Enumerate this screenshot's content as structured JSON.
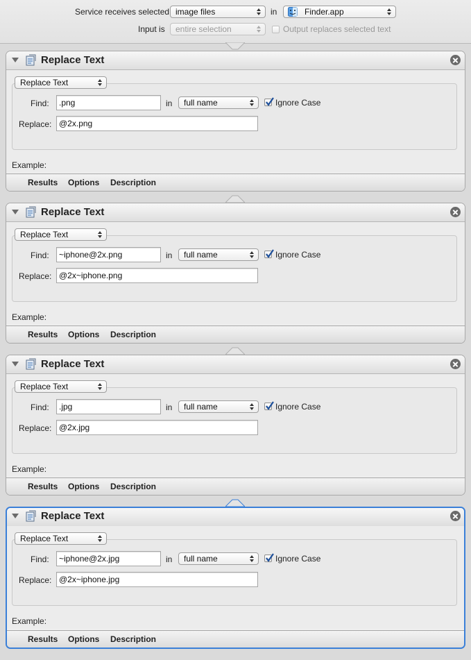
{
  "header": {
    "service_receives_label": "Service receives selected",
    "service_receives_value": "image files",
    "in_label": "in",
    "app_value": "Finder.app",
    "input_is_label": "Input is",
    "input_is_value": "entire selection",
    "output_replaces_label": "Output replaces selected text",
    "output_replaces_checked": false
  },
  "actions": [
    {
      "title": "Replace Text",
      "mode": "Replace Text",
      "find_label": "Find:",
      "find_value": ".png",
      "in_label": "in",
      "in_value": "full name",
      "ignore_case_label": "Ignore Case",
      "ignore_case_checked": true,
      "replace_label": "Replace:",
      "replace_value": "@2x.png",
      "example_label": "Example:",
      "tabs": [
        "Results",
        "Options",
        "Description"
      ],
      "selected": false
    },
    {
      "title": "Replace Text",
      "mode": "Replace Text",
      "find_label": "Find:",
      "find_value": "~iphone@2x.png",
      "in_label": "in",
      "in_value": "full name",
      "ignore_case_label": "Ignore Case",
      "ignore_case_checked": true,
      "replace_label": "Replace:",
      "replace_value": "@2x~iphone.png",
      "example_label": "Example:",
      "tabs": [
        "Results",
        "Options",
        "Description"
      ],
      "selected": false
    },
    {
      "title": "Replace Text",
      "mode": "Replace Text",
      "find_label": "Find:",
      "find_value": ".jpg",
      "in_label": "in",
      "in_value": "full name",
      "ignore_case_label": "Ignore Case",
      "ignore_case_checked": true,
      "replace_label": "Replace:",
      "replace_value": "@2x.jpg",
      "example_label": "Example:",
      "tabs": [
        "Results",
        "Options",
        "Description"
      ],
      "selected": false
    },
    {
      "title": "Replace Text",
      "mode": "Replace Text",
      "find_label": "Find:",
      "find_value": "~iphone@2x.jpg",
      "in_label": "in",
      "in_value": "full name",
      "ignore_case_label": "Ignore Case",
      "ignore_case_checked": true,
      "replace_label": "Replace:",
      "replace_value": "@2x~iphone.jpg",
      "example_label": "Example:",
      "tabs": [
        "Results",
        "Options",
        "Description"
      ],
      "selected": true
    }
  ],
  "colors": {
    "selection_border": "#3a7fd8",
    "workflow_background": "#dadada"
  },
  "icons": {
    "app": "finder-icon",
    "action": "automator-action-icon",
    "close": "close-icon",
    "disclosure": "disclosure-triangle-icon"
  }
}
